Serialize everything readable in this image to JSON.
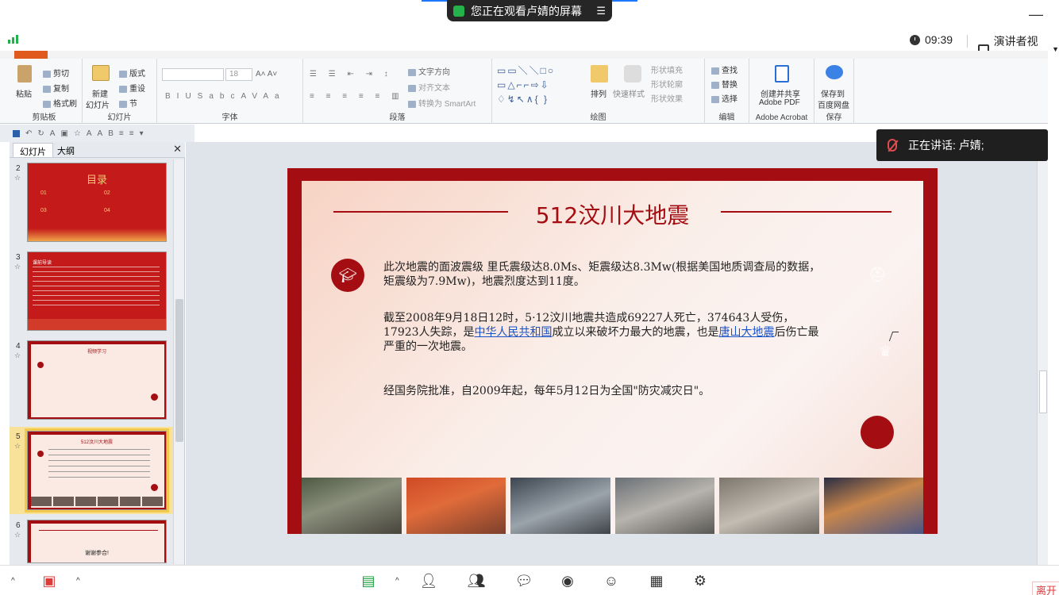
{
  "meeting": {
    "banner_text": "您正在观看卢婧的屏幕",
    "clock": "09:39",
    "view_mode": "演讲者视图",
    "speaking_label": "正在讲话:",
    "speaking_name": "卢婧;",
    "leave_label": "离开"
  },
  "ribbon": {
    "clipboard": {
      "paste": "粘贴",
      "cut": "剪切",
      "copy": "复制",
      "format_painter": "格式刷",
      "group": "剪贴板"
    },
    "slides": {
      "new_slide": "新建",
      "new_slide2": "幻灯片",
      "layout": "版式",
      "reset": "重设",
      "section": "节",
      "group": "幻灯片"
    },
    "font": {
      "size": "18",
      "group": "字体"
    },
    "paragraph": {
      "text_direction": "文字方向",
      "align_text": "对齐文本",
      "smartart": "转换为 SmartArt",
      "group": "段落"
    },
    "drawing": {
      "arrange": "排列",
      "quick_styles": "快速样式",
      "shape_fill": "形状填充",
      "shape_outline": "形状轮廓",
      "shape_effects": "形状效果",
      "group": "绘图"
    },
    "editing": {
      "find": "查找",
      "replace": "替换",
      "select": "选择",
      "group": "编辑"
    },
    "acrobat": {
      "create": "创建并共享",
      "create2": "Adobe PDF",
      "group": "Adobe Acrobat"
    },
    "save": {
      "save": "保存到",
      "save2": "百度网盘",
      "group": "保存"
    }
  },
  "panel": {
    "tab_slides": "幻灯片",
    "tab_outline": "大纲",
    "thumbs": [
      {
        "num": "2",
        "title": "目录",
        "items": [
          "01",
          "02",
          "03",
          "04"
        ]
      },
      {
        "num": "3",
        "title": "课前导读"
      },
      {
        "num": "4",
        "title": "视频学习"
      },
      {
        "num": "5",
        "title": "512汶川大地震"
      },
      {
        "num": "6",
        "title": "谢谢参合!"
      }
    ]
  },
  "slide": {
    "title": "512汶川大地震",
    "para1": "此次地震的面波震级 里氏震级达8.0Ms、矩震级达8.3Mw(根据美国地质调查局的数据，矩震级为7.9Mw)，地震烈度达到11度。",
    "para2_a": "截至2008年9月18日12时，5·12汶川地震共造成69227人死亡，374643人受伤，17923人失踪，是",
    "para2_link1": "中华人民共和国",
    "para2_b": "成立以来破坏力最大的地震，也是",
    "para2_link2": "唐山大地震",
    "para2_c": "后伤亡最严重的一次地震。",
    "para3": "经国务院批准，自2009年起，每年5月12日为全国\"防灾减灾日\"。",
    "photo_captions": [
      "",
      "",
      "",
      "",
      "",
      ""
    ]
  },
  "colors": {
    "accent": "#a40e12",
    "link": "#1a52c8",
    "share_green": "#24b24a"
  }
}
